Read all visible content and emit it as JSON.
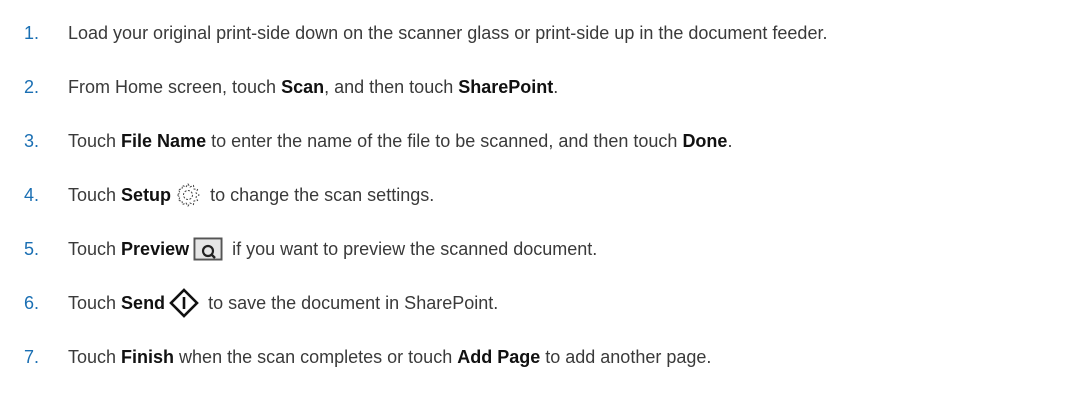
{
  "steps": [
    {
      "number": "1.",
      "text": "Load your original print-side down on the scanner glass or print-side up in the document feeder."
    },
    {
      "number": "2.",
      "p1": "From Home screen, touch ",
      "b1": "Scan",
      "p2": ", and then touch ",
      "b2": "SharePoint",
      "p3": "."
    },
    {
      "number": "3.",
      "p1": "Touch ",
      "b1": "File Name",
      "p2": " to enter the name of the file to be scanned, and then touch ",
      "b2": "Done",
      "p3": "."
    },
    {
      "number": "4.",
      "p1": "Touch ",
      "b1": "Setup",
      "icon": "gear-icon",
      "p2": " to change the scan settings."
    },
    {
      "number": "5.",
      "p1": "Touch ",
      "b1": "Preview",
      "icon": "preview-icon",
      "p2": " if you want to preview the scanned document."
    },
    {
      "number": "6.",
      "p1": "Touch ",
      "b1": "Send",
      "icon": "send-icon",
      "p2": " to save the document in SharePoint."
    },
    {
      "number": "7.",
      "p1": "Touch ",
      "b1": "Finish",
      "p2": " when the scan completes or touch ",
      "b2": "Add Page",
      "p3": " to add another page."
    }
  ],
  "colors": {
    "step_number": "#1a6fb3",
    "body_text": "#3a3a3a",
    "bold_text": "#111111"
  }
}
